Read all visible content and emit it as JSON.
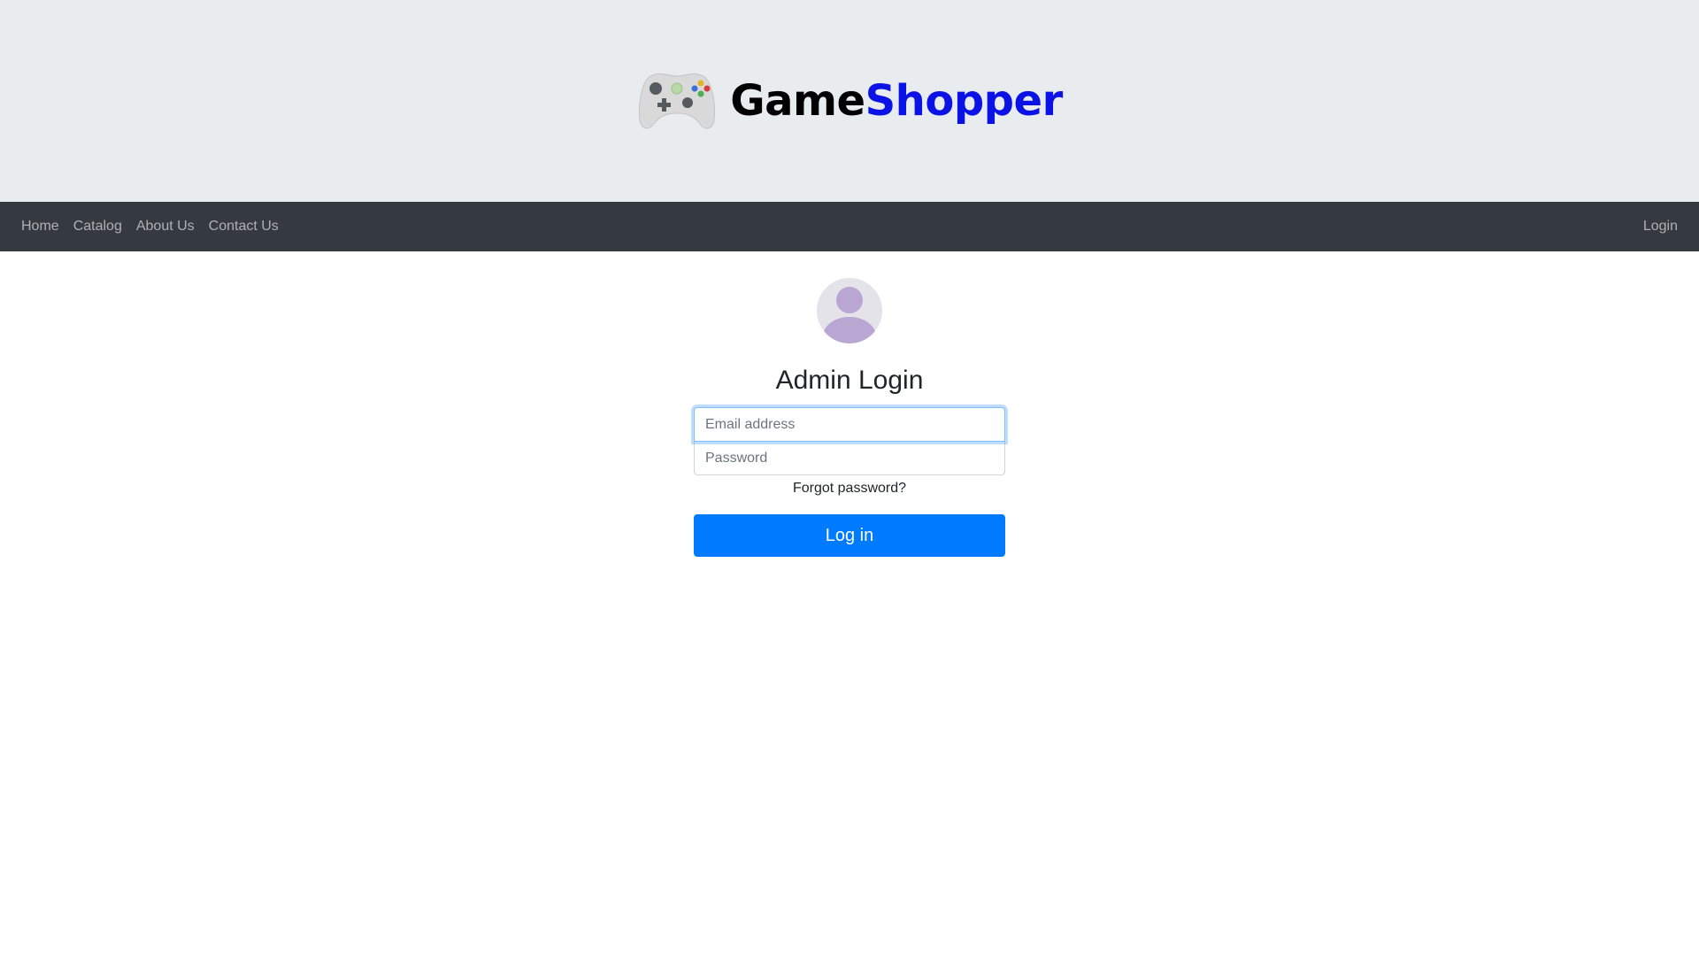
{
  "brand": {
    "name_part1": "Game",
    "name_part2": "Shopper",
    "icon": "gamepad-icon",
    "colors": {
      "part1": "#000000",
      "part2": "#0a12e6"
    }
  },
  "nav": {
    "links": [
      {
        "label": "Home"
      },
      {
        "label": "Catalog"
      },
      {
        "label": "About Us"
      },
      {
        "label": "Contact Us"
      }
    ],
    "login_label": "Login",
    "background": "#343a40"
  },
  "login": {
    "avatar_icon": "user-avatar-icon",
    "title": "Admin Login",
    "email_placeholder": "Email address",
    "email_value": "",
    "password_placeholder": "Password",
    "password_value": "",
    "forgot_label": "Forgot password?",
    "submit_label": "Log in",
    "accent": "#007bff"
  }
}
